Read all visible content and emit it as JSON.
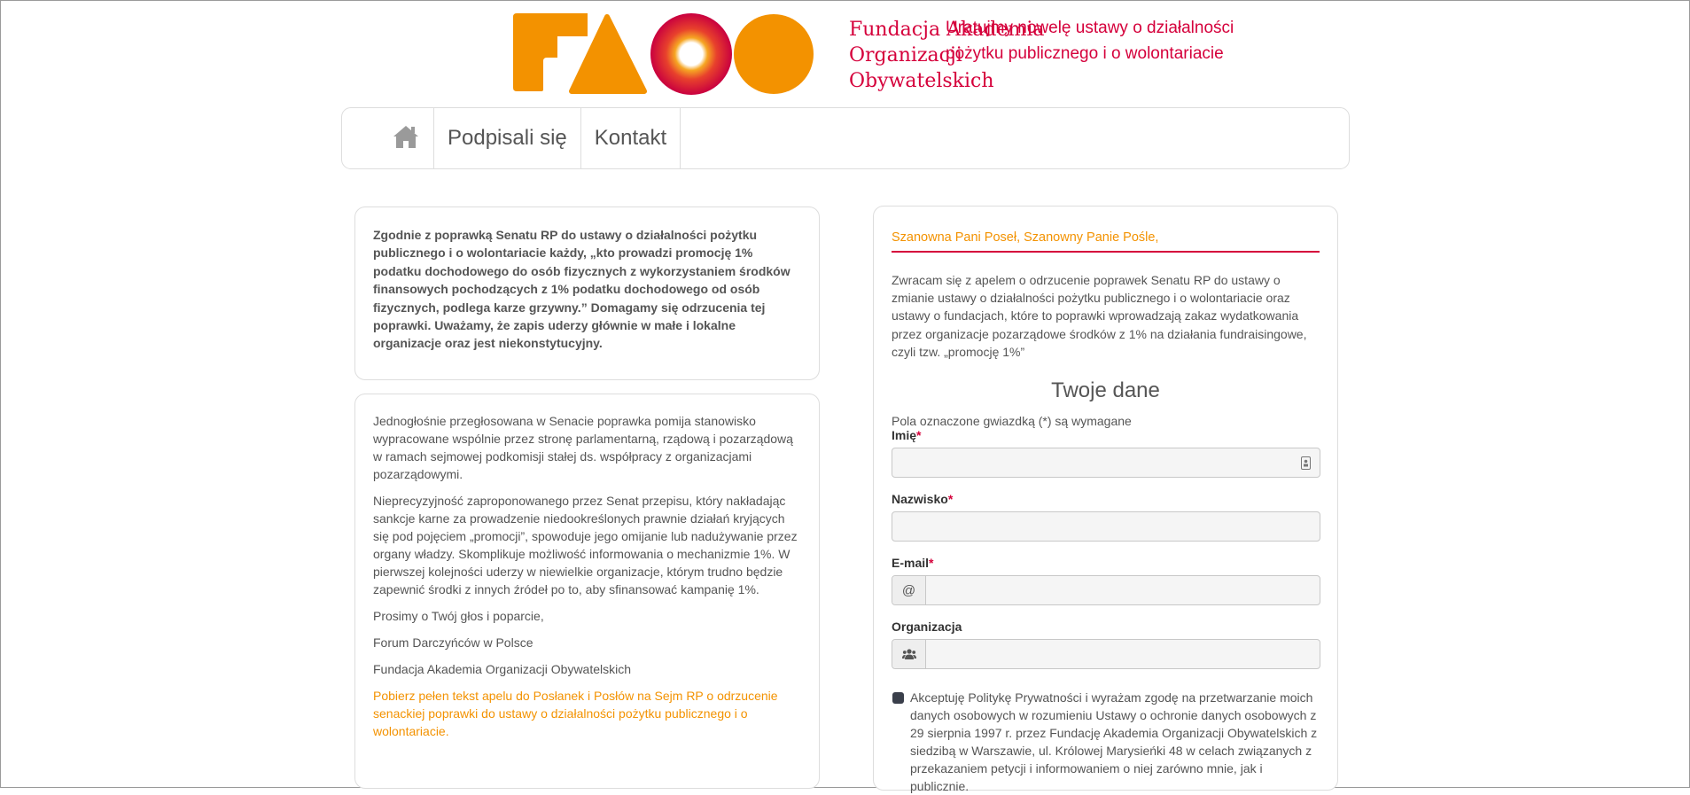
{
  "header": {
    "logo_text": "FAOO",
    "org_name": "Fundacja Akademia Organizacji Obywatelskich",
    "tagline": "Uratujmy nowelę ustawy o działalności pożytku publicznego i o wolontariacie"
  },
  "nav": {
    "home_icon": "home-icon",
    "items": [
      {
        "label": "Podpisali się"
      },
      {
        "label": "Kontakt"
      }
    ]
  },
  "left": {
    "lead": "Zgodnie z poprawką Senatu RP do ustawy o działalności pożytku publicznego i o wolontariacie każdy, „kto prowadzi promocję 1% podatku dochodowego do osób fizycznych z wykorzystaniem środków finansowych pochodzących z 1% podatku dochodowego od osób fizycznych, podlega karze grzywny.” Domagamy się odrzucenia tej poprawki. Uważamy, że zapis uderzy głównie w małe i lokalne organizacje oraz jest niekonstytucyjny.",
    "paragraphs": [
      "Jednogłośnie przegłosowana w Senacie poprawka pomija stanowisko wypracowane wspólnie przez stronę parlamentarną, rządową i pozarządową w ramach sejmowej podkomisji stałej ds. współpracy z organizacjami pozarządowymi.",
      "Nieprecyzyjność zaproponowanego przez Senat przepisu, który nakładając sankcje karne za prowadzenie niedookreślonych prawnie działań kryjących się pod pojęciem „promocji”, spowoduje jego omijanie lub nadużywanie przez organy władzy. Skomplikuje możliwość informowania o mechanizmie 1%. W pierwszej kolejności uderzy w niewielkie organizacje, którym trudno będzie zapewnić środki z innych źródeł po to, aby sfinansować kampanię 1%.",
      "Prosimy o Twój głos i poparcie,",
      "Forum Darczyńców w Polsce",
      "Fundacja Akademia Organizacji Obywatelskich"
    ],
    "download_link": "Pobierz pełen tekst apelu do Posłanek i Posłów na Sejm RP o odrzucenie senackiej poprawki do ustawy o działalności pożytku publicznego i o wolontariacie."
  },
  "form": {
    "greeting": "Szanowna Pani Poseł, Szanowny Panie Pośle,",
    "intro": "Zwracam się z apelem o odrzucenie poprawek Senatu RP do ustawy o zmianie ustawy o działalności pożytku publicznego i o wolontariacie oraz ustawy o fundacjach, które to poprawki wprowadzają zakaz wydatkowania przez organizacje pozarządowe środków z 1% na działania fundraisingowe, czyli tzw. „promocję 1%”",
    "section_title": "Twoje dane",
    "required_note": "Pola oznaczone gwiazdką (*) są wymagane",
    "fields": {
      "first_name": {
        "label": "Imię",
        "required": "*",
        "value": ""
      },
      "last_name": {
        "label": "Nazwisko",
        "required": "*",
        "value": ""
      },
      "email": {
        "label": "E-mail",
        "required": "*",
        "addon": "@",
        "value": ""
      },
      "organization": {
        "label": "Organizacja",
        "required": "",
        "addon_icon": "users-icon",
        "value": ""
      }
    },
    "consent_text": "Akceptuję Politykę Prywatności i wyrażam zgodę na przetwarzanie moich danych osobowych w rozumieniu Ustawy o ochronie danych osobowych z 29 sierpnia 1997 r. przez Fundację Akademia Organizacji Obywatelskich z siedzibą w Warszawie, ul. Królowej Marysieńki 48 w celach związanych z przekazaniem petycji i informowaniem o niej zarówno mnie, jak i publicznie."
  },
  "colors": {
    "brand_orange": "#f39200",
    "brand_red": "#d5003b",
    "text": "#555555",
    "border": "#dddddd"
  }
}
